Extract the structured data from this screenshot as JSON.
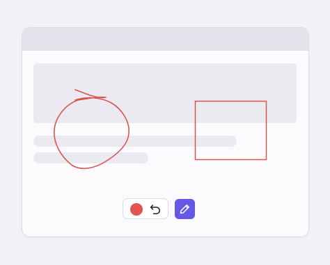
{
  "window": {
    "title": ""
  },
  "toolbar": {
    "active_color": "#e05454",
    "color_swatch_icon": "color-dot-icon",
    "undo_icon": "undo-arrow-icon",
    "pen_icon": "pencil-icon",
    "pen_active_color": "#6658e6"
  },
  "annotations": [
    {
      "type": "freehand-circle",
      "color": "#d9534f"
    },
    {
      "type": "rectangle",
      "color": "#d9534f"
    }
  ]
}
